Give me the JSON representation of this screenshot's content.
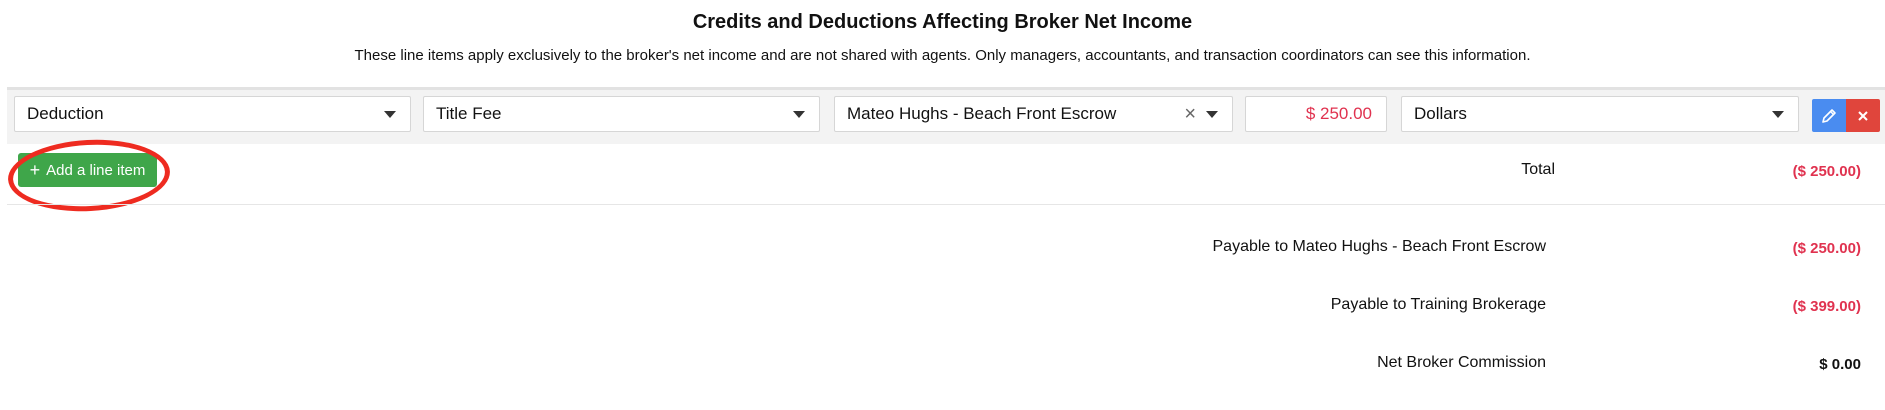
{
  "header": {
    "title": "Credits and Deductions Affecting Broker Net Income",
    "subtitle": "These line items apply exclusively to the broker's net income and are not shared with agents. Only managers, accountants, and transaction coordinators can see this information."
  },
  "line_item": {
    "type": "Deduction",
    "category": "Title Fee",
    "payee": "Mateo Hughs - Beach Front Escrow",
    "amount": "$ 250.00",
    "unit": "Dollars",
    "edit_icon": "pencil-icon",
    "delete_icon": "close-icon",
    "clear_icon": "×"
  },
  "actions": {
    "add_line_item_label": "Add a line item",
    "add_icon": "+"
  },
  "totals": {
    "total_label": "Total",
    "total_value": "($ 250.00)",
    "payable_rows": [
      {
        "label": "Payable to Mateo Hughs - Beach Front Escrow",
        "value": "($ 250.00)"
      },
      {
        "label": "Payable to Training Brokerage",
        "value": "($ 399.00)"
      }
    ],
    "net_label": "Net Broker Commission",
    "net_value": "$ 0.00"
  },
  "colors": {
    "negative": "#e0324f",
    "add_button": "#3fa64a",
    "edit_button": "#4a8cf0",
    "delete_button": "#e0453c",
    "annotation_ring": "#ee2b20"
  }
}
